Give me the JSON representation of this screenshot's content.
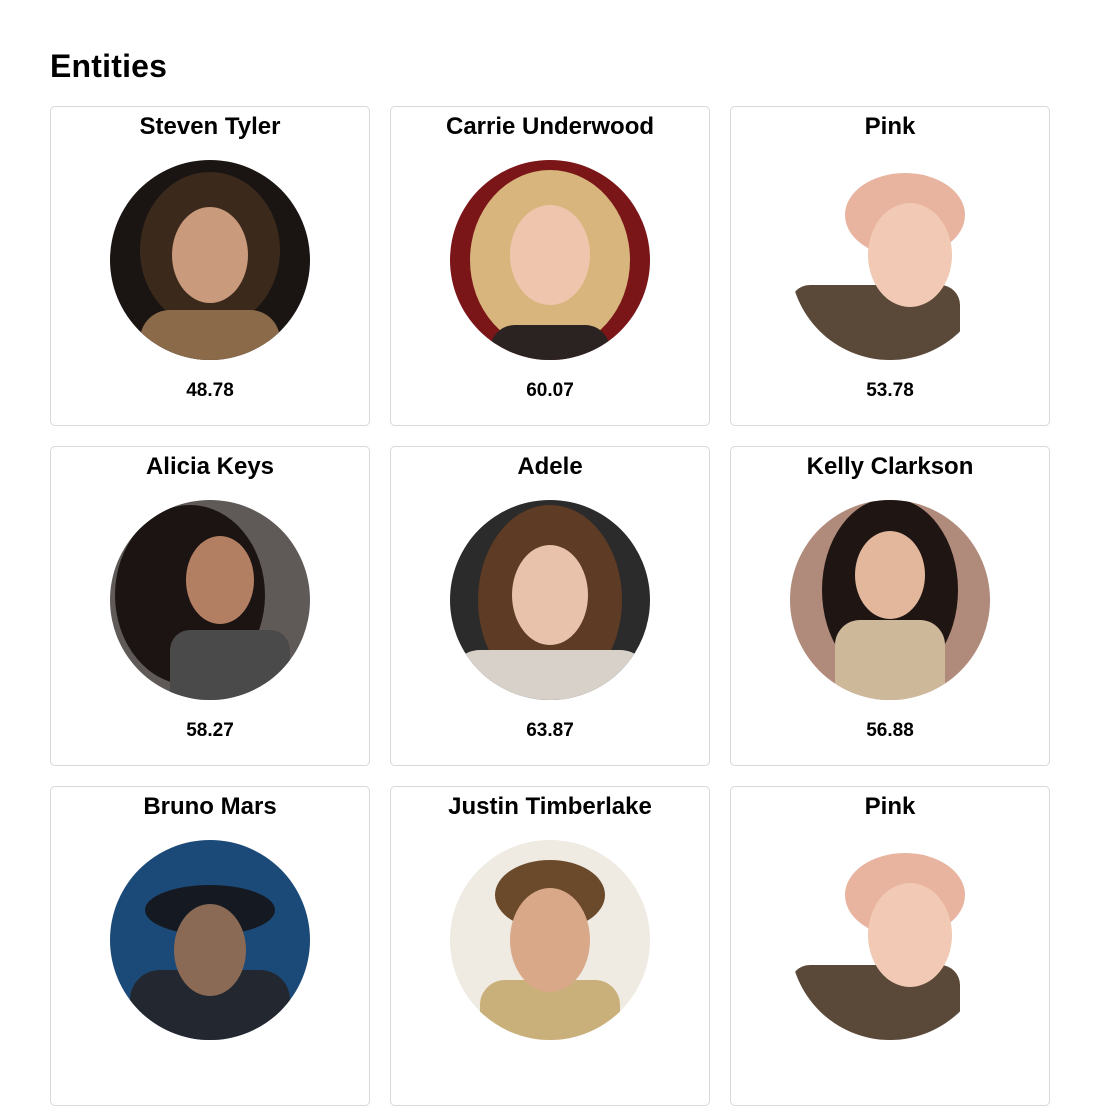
{
  "header": {
    "title": "Entities"
  },
  "entities": [
    {
      "name": "Steven Tyler",
      "score": "48.78",
      "photo": "steven-tyler-photo",
      "colors": {
        "bg": "#1a1512",
        "hair": "#3b2a1c",
        "skin": "#c99a7c",
        "cloth": "#8a6a48"
      }
    },
    {
      "name": "Carrie Underwood",
      "score": "60.07",
      "photo": "carrie-underwood-photo",
      "colors": {
        "bg": "#7a1518",
        "hair": "#d7b57c",
        "skin": "#efc6ad",
        "cloth": "#2b2222"
      }
    },
    {
      "name": "Pink",
      "score": "53.78",
      "photo": "pink-photo",
      "colors": {
        "bg": "#ffffff",
        "hair": "#e8b4a0",
        "skin": "#f1c9b4",
        "cloth": "#5a4838"
      }
    },
    {
      "name": "Alicia Keys",
      "score": "58.27",
      "photo": "alicia-keys-photo",
      "colors": {
        "bg": "#5f5a58",
        "hair": "#1b1412",
        "skin": "#b27f63",
        "cloth": "#4a4a4a"
      }
    },
    {
      "name": "Adele",
      "score": "63.87",
      "photo": "adele-photo",
      "colors": {
        "bg": "#2c2b2b",
        "hair": "#5d3b24",
        "skin": "#e8c2ab",
        "cloth": "#d8d1c9"
      }
    },
    {
      "name": "Kelly Clarkson",
      "score": "56.88",
      "photo": "kelly-clarkson-photo",
      "colors": {
        "bg": "#b08a7a",
        "hair": "#1f1513",
        "skin": "#e2b79c",
        "cloth": "#cdb89a"
      }
    },
    {
      "name": "Bruno Mars",
      "score": "",
      "photo": "bruno-mars-photo",
      "colors": {
        "bg": "#1c4a78",
        "hair": "#151a22",
        "skin": "#8a6a55",
        "cloth": "#23272f"
      }
    },
    {
      "name": "Justin Timberlake",
      "score": "",
      "photo": "justin-timberlake-photo",
      "colors": {
        "bg": "#efeae2",
        "hair": "#6b4a2c",
        "skin": "#d9a889",
        "cloth": "#c9b07a"
      }
    },
    {
      "name": "Pink",
      "score": "",
      "photo": "pink-photo",
      "colors": {
        "bg": "#ffffff",
        "hair": "#e8b4a0",
        "skin": "#f1c9b4",
        "cloth": "#5a4838"
      }
    }
  ]
}
